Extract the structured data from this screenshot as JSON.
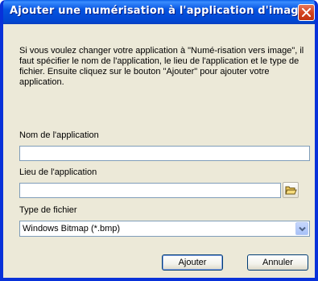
{
  "window": {
    "title": "Ajouter une numérisation à l'application d'image",
    "close_icon": "close-icon"
  },
  "description": "Si vous voulez changer votre application à \"Numé-risation vers image\", il faut spécifier le nom de l'application, le lieu de l'application et le type de fichier. Ensuite cliquez sur le bouton \"Ajouter\" pour ajouter votre application.",
  "fields": {
    "app_name": {
      "label": "Nom de l'application",
      "value": ""
    },
    "app_location": {
      "label": "Lieu de l'application",
      "value": "",
      "browse_icon": "folder-open-icon"
    },
    "file_type": {
      "label": "Type de fichier",
      "selected": "Windows Bitmap (*.bmp)",
      "dropdown_icon": "chevron-down-icon"
    }
  },
  "buttons": {
    "add_label": "Ajouter",
    "cancel_label": "Annuler"
  },
  "colors": {
    "titlebar": "#0553e0",
    "close_button": "#d54522",
    "dialog_bg": "#ece9d8",
    "field_border": "#7f9db9",
    "button_border": "#003c74"
  }
}
